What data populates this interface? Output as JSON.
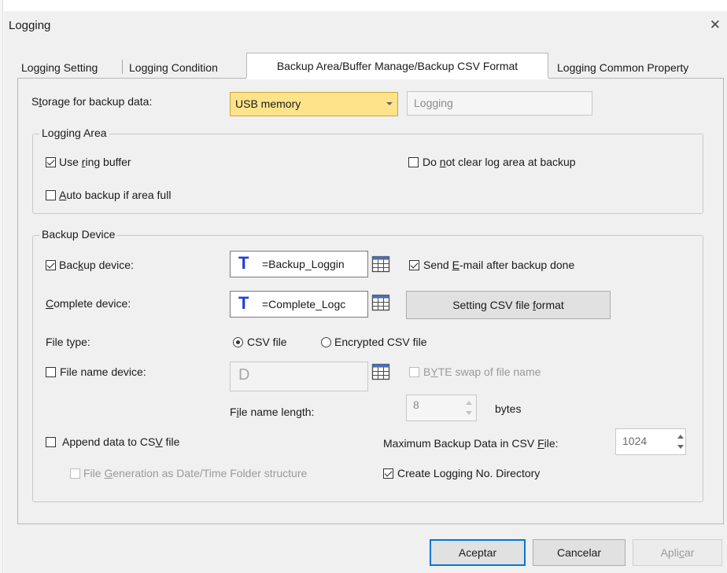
{
  "window": {
    "title": "Logging"
  },
  "tabs": [
    {
      "label": "Logging Setting",
      "active": false
    },
    {
      "label": "Logging Condition",
      "active": false
    },
    {
      "label": "Backup Area/Buffer Manage/Backup CSV Format",
      "active": true
    },
    {
      "label": "Logging Common Property",
      "active": false
    }
  ],
  "storage": {
    "label_pre": "S",
    "label_ul": "t",
    "label_post": "orage for backup data:",
    "selected": "USB memory",
    "folder_value": "Logging"
  },
  "logging_area": {
    "title": "Logging Area",
    "ring_buffer": {
      "pre": "Use ",
      "ul": "r",
      "post": "ing buffer",
      "checked": true
    },
    "auto_backup": {
      "pre": "",
      "ul": "A",
      "post": "uto backup if area full",
      "checked": false
    },
    "do_not_clear": {
      "pre": "Do ",
      "ul": "n",
      "post": "ot clear log area at backup",
      "checked": false
    }
  },
  "backup_device": {
    "title": "Backup Device",
    "backup_device": {
      "pre": "Bac",
      "ul": "k",
      "post": "up device:",
      "checked": true,
      "value": "=Backup_Loggin"
    },
    "complete_device": {
      "pre": "",
      "ul": "C",
      "post": "omplete device:",
      "value": "=Complete_Logc"
    },
    "send_email": {
      "pre": "Send ",
      "ul": "E",
      "post": "-mail after backup done",
      "checked": true
    },
    "csv_format_button": {
      "pre": "Setting CSV file ",
      "ul": "f",
      "post": "ormat"
    },
    "file_type": {
      "label": "File type:",
      "options": [
        "CSV file",
        "Encrypted CSV file"
      ],
      "selected": "CSV file"
    },
    "file_name_device": {
      "label": "File name device:",
      "checked": false,
      "value": "D"
    },
    "byte_swap": {
      "pre": "B",
      "ul": "Y",
      "post": "TE swap of file name",
      "checked": false
    },
    "file_name_length": {
      "pre": "F",
      "ul": "i",
      "post": "le name length:",
      "value": "8",
      "unit": "bytes"
    },
    "append_csv": {
      "pre": "Append data to CS",
      "ul": "V",
      "post": " file",
      "checked": false
    },
    "max_backup": {
      "pre": "Maximum Backup Data in CSV ",
      "ul": "F",
      "post": "ile:",
      "value": "1024"
    },
    "file_generation": {
      "pre": "File ",
      "ul": "G",
      "post": "eneration as Date/Time Folder structure",
      "checked": false
    },
    "create_dir": {
      "label": "Create Logging No. Directory",
      "checked": true
    }
  },
  "footer": {
    "ok": "Aceptar",
    "cancel": "Cancelar",
    "apply_pre": "Apli",
    "apply_ul": "c",
    "apply_post": "ar"
  }
}
